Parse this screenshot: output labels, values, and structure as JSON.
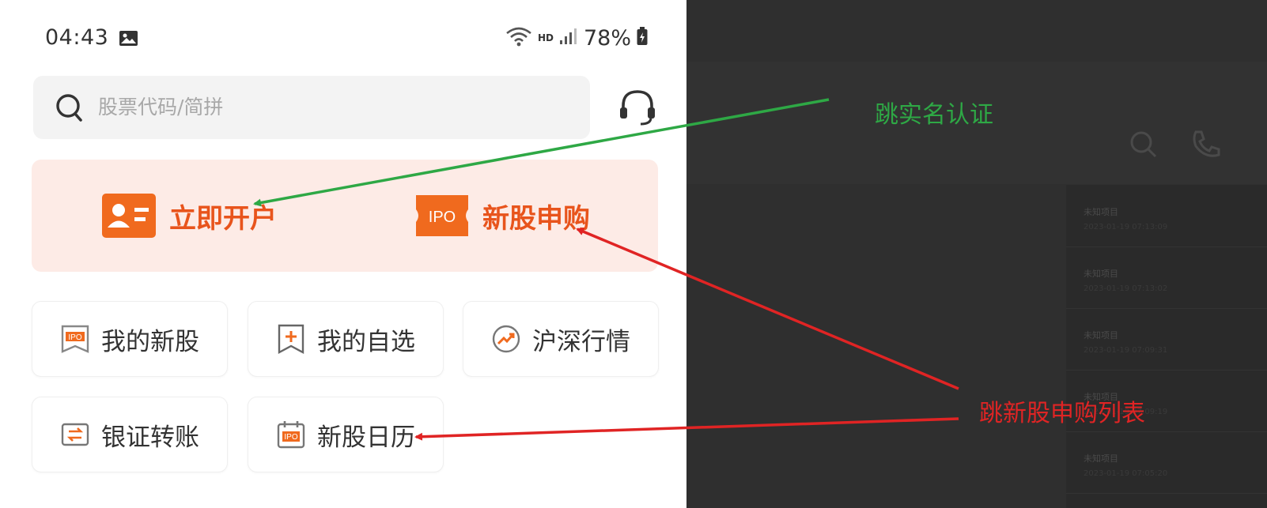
{
  "status_bar": {
    "time": "04:43",
    "hd": "HD",
    "battery": "78%",
    "icons": [
      "gallery-icon",
      "wifi-icon",
      "signal-icon",
      "battery-icon"
    ]
  },
  "search": {
    "placeholder": "股票代码/简拼"
  },
  "promo": {
    "open_account": "立即开户",
    "ipo_subscribe": "新股申购",
    "ipo_badge": "IPO"
  },
  "quick_tiles": [
    {
      "label": "我的新股",
      "icon": "ipo-flag-icon"
    },
    {
      "label": "我的自选",
      "icon": "bookmark-plus-icon"
    },
    {
      "label": "沪深行情",
      "icon": "trend-chart-icon"
    },
    {
      "label": "银证转账",
      "icon": "transfer-icon"
    },
    {
      "label": "新股日历",
      "icon": "ipo-calendar-icon"
    }
  ],
  "overlay_list": [
    {
      "title": "未知项目",
      "time": "2023-01-19 07:13:09"
    },
    {
      "title": "未知项目",
      "time": "2023-01-19 07:13:02"
    },
    {
      "title": "未知项目",
      "time": "2023-01-19 07:09:31"
    },
    {
      "title": "未知项目",
      "time": "2023-01-19 07:09:19"
    },
    {
      "title": "未知项目",
      "time": "2023-01-19 07:05:20"
    }
  ],
  "annotations": {
    "realname_note": "跳实名认证",
    "ipo_list_note": "跳新股申购列表",
    "green": "#2ea845",
    "red": "#e02424"
  },
  "colors": {
    "brand_orange": "#e8541c",
    "promo_bg": "#fdebe6"
  }
}
